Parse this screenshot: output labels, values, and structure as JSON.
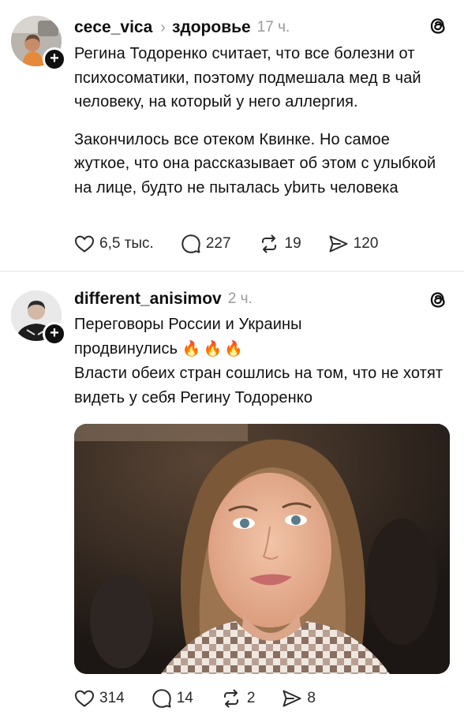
{
  "posts": [
    {
      "username": "cece_vica",
      "topic": "здоровье",
      "time": "17 ч.",
      "paragraphs": [
        "Регина Тодоренко считает, что все болезни от психосоматики, поэтому подмешала мед в чай человеку, на который у него аллергия.",
        "Закончилось все отеком Квинке. Но самое жуткое, что она рассказывает об этом с улыбкой на лице, будто не пыталась уbить человека"
      ],
      "likes": "6,5 тыс.",
      "comments": "227",
      "reposts": "19",
      "shares": "120"
    },
    {
      "username": "different_anisimov",
      "time": "2 ч.",
      "line1": "Переговоры России и Украины",
      "line2": "продвинулись",
      "emoji": "🔥🔥🔥",
      "line3": "Власти обеих стран сошлись на том, что не хотят видеть у себя Регину Тодоренко",
      "likes": "314",
      "comments": "14",
      "reposts": "2",
      "shares": "8"
    }
  ],
  "icons": {
    "chevron": "›",
    "plus": "+"
  },
  "colors": {
    "text": "#101010",
    "muted": "#9a9a9a",
    "divider": "#e6e6e6"
  }
}
